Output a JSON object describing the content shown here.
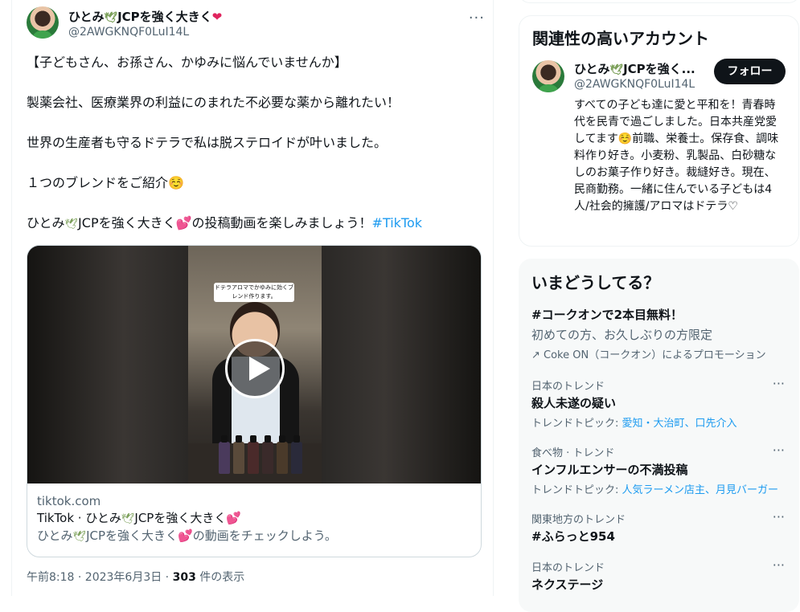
{
  "tweet": {
    "author_name": "ひとみ",
    "author_name_suffix": "JCPを強く大きく",
    "author_handle": "@2AWGKNQF0LuI14L",
    "more": "···",
    "lines": [
      "【子どもさん、お孫さん、かゆみに悩んでいませんか】",
      "製薬会社、医療業界の利益にのまれた不必要な薬から離れたい！",
      "世界の生産者も守るドテラで私は脱ステロイドが叶いました。",
      "１つのブレンドをご紹介☺️"
    ],
    "last_line_prefix": "ひとみ",
    "last_line_mid": "JCPを強く大きく",
    "last_line_suffix": "の投稿動画を楽しみましょう！",
    "hashtag": "#TikTok",
    "timestamp": "午前8:18 · 2023年6月3日 · ",
    "views_count": "303",
    "views_label": " 件の表示"
  },
  "card": {
    "video_caption": "ドテラアロマでかゆみに効くブレンド作ります。",
    "domain": "tiktok.com",
    "title_prefix": "TikTok · ひとみ",
    "title_mid": "JCPを強く大きく",
    "desc_prefix": "ひとみ",
    "desc_mid": "JCPを強く大きく",
    "desc_suffix": "の動画をチェックしよう。"
  },
  "related": {
    "title": "関連性の高いアカウント",
    "name": "ひとみ",
    "name_suffix": "JCPを強く...",
    "handle": "@2AWGKNQF0LuI14L",
    "follow_label": "フォロー",
    "bio": "すべての子ども達に愛と平和を！青春時代を民青で過ごしました。日本共産党愛してます☺️前職、栄養士。保存食、調味料作り好き。小麦粉、乳製品、白砂糖なしのお菓子作り好き。裁縫好き。現在、民商勤務。一緒に住んでいる子どもは4人/社会的擁護/アロマはドテラ♡"
  },
  "trends": {
    "title": "いまどうしてる？",
    "promo": {
      "title": "#コークオンで2本目無料！",
      "desc": "初めての方、お久しぶりの方限定",
      "by": "Coke ON（コークオン）によるプロモーション"
    },
    "items": [
      {
        "category": "日本のトレンド",
        "title": "殺人未遂の疑い",
        "topics_label": "トレンドトピック: ",
        "topics": "愛知・大治町、口先介入"
      },
      {
        "category": "食べ物 · トレンド",
        "title": "インフルエンサーの不満投稿",
        "topics_label": "トレンドトピック: ",
        "topics": "人気ラーメン店主、月見バーガー"
      },
      {
        "category": "関東地方のトレンド",
        "title": "#ふらっと954",
        "topics_label": "",
        "topics": ""
      },
      {
        "category": "日本のトレンド",
        "title": "ネクステージ",
        "topics_label": "",
        "topics": ""
      }
    ],
    "more": "···"
  },
  "colors": {
    "accent": "#1d9bf0",
    "heart": "#e0245e",
    "text_secondary": "#536471",
    "follow_bg": "#0f1419"
  }
}
